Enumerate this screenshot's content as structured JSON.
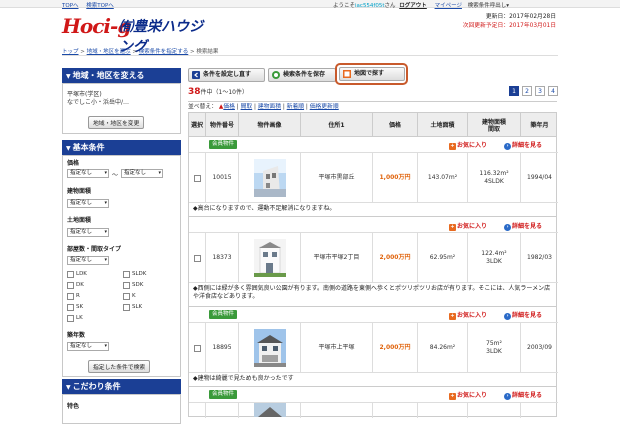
{
  "top_links": [
    "TOPへ",
    "検索TOPへ"
  ],
  "user": {
    "prefix": "ようこそ",
    "id": "iac554f05t",
    "suffix": "さん",
    "logout": "ログアウト",
    "mypage": "マイページ",
    "saved": "検索条件呼出し"
  },
  "logo": {
    "mark": "Hoci-g",
    "name": "㈲豊栄ハウジング"
  },
  "update": {
    "updated_label": "更新日",
    "updated_date": "2017年02月28日",
    "next_label": "次回更新予定日",
    "next_date": "2017年03月01日"
  },
  "breadcrumb": [
    "トップ",
    "地域・地区を選ぶ",
    "検索条件を指定する",
    "検索結果"
  ],
  "sidebar": {
    "area_title": "地域・地区を変える",
    "area_text1": "平塚市(学区)",
    "area_text2": "なでしこ小・浜岳中/…",
    "area_btn": "地域・地区を変更",
    "basic_title": "基本条件",
    "price_label": "価格",
    "price_from": "指定なし",
    "tilde": "〜",
    "price_to": "指定なし",
    "building_label": "建物面積",
    "building_val": "指定なし",
    "land_label": "土地面積",
    "land_val": "指定なし",
    "layout_label": "部屋数・間取タイプ",
    "layout_val": "指定なし",
    "layouts": [
      "LDK",
      "SLDK",
      "DK",
      "SDK",
      "R",
      "K",
      "SK",
      "SLK",
      "LK"
    ],
    "age_label": "築年数",
    "age_val": "指定なし",
    "search_btn": "指定した条件で検索",
    "extra_title": "こだわり条件",
    "feature_label": "特色"
  },
  "toolbar": {
    "reset": "条件を設定し直す",
    "save": "検索条件を保存",
    "map": "地図で探す"
  },
  "results": {
    "count": "38",
    "count_suffix": "件中（1〜10件）",
    "pages": [
      "1",
      "2",
      "3",
      "4"
    ]
  },
  "sort": {
    "label": "並べ替え：",
    "options": [
      "価格",
      "間取",
      "建物面積",
      "新着順",
      "価格更新順"
    ]
  },
  "columns": [
    "選択",
    "物件番号",
    "物件画像",
    "住所1",
    "価格",
    "土地面積",
    "建物面積\n間取",
    "築年月"
  ],
  "labels": {
    "badge": "会員物件",
    "fav": "お気に入り",
    "detail": "詳細を見る"
  },
  "listings": [
    {
      "id": "10015",
      "address": "平塚市黒部丘",
      "price": "1,000万円",
      "land": "143.07m²",
      "building": "116.32m²",
      "layout": "4SLDK",
      "built": "1994/04",
      "comment": "◆高台になりますので、運動不足解消になりますね。"
    },
    {
      "id": "18373",
      "address": "平塚市平塚2丁目",
      "price": "2,000万円",
      "land": "62.95m²",
      "building": "122.4m²",
      "layout": "3LDK",
      "built": "1982/03",
      "comment": "◆西側には緑が多く雰囲気良い公園が有ります。南側の道路を東側へ歩くとポツリポツリお店が有ります。そこには、人気ラーメン店や洋食店などあります。"
    },
    {
      "id": "18895",
      "address": "平塚市上平塚",
      "price": "2,000万円",
      "land": "84.26m²",
      "building": "75m²",
      "layout": "3LDK",
      "built": "2003/09",
      "comment": "◆建物は綺麗で見ためも良かったです"
    }
  ]
}
